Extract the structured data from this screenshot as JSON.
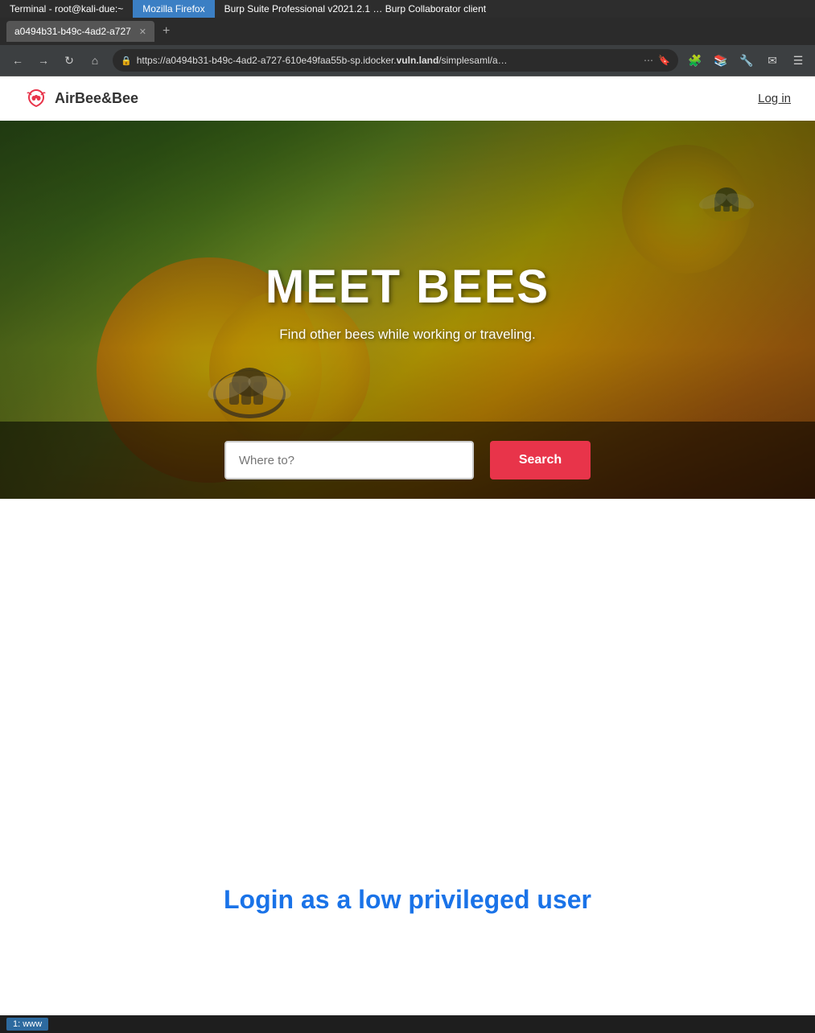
{
  "taskbar": {
    "items": [
      {
        "label": "Terminal - root@kali-due:~",
        "active": false
      },
      {
        "label": "Mozilla Firefox",
        "active": true
      },
      {
        "label": "Burp Suite Professional v2021.2.1 … Burp Collaborator client",
        "active": false
      }
    ]
  },
  "browser": {
    "tab_title": "a0494b31-b49c-4ad2-a727",
    "url_display": "https://a0494b31-b49c-4ad2-a727-610e49faa55b-sp.idocker.vuln.land/simplesaml/a…",
    "url_domain": "vuln.land",
    "url_prefix": "https://a0494b31-b49c-4ad2-a727-610e49faa55b-sp.idocker.",
    "url_suffix": "/simplesaml/a…"
  },
  "site": {
    "logo_text": "AirBee&Bee",
    "login_label": "Log in",
    "hero": {
      "title": "MEET BEES",
      "subtitle": "Find other bees while working or traveling."
    },
    "search": {
      "placeholder": "Where to?",
      "button_label": "Search"
    },
    "bottom": {
      "heading": "Login as a low privileged user"
    }
  },
  "status_bar": {
    "item": "1: www"
  },
  "colors": {
    "search_button": "#e8344a",
    "login_link": "#1a73e8",
    "bottom_heading": "#1a73e8"
  }
}
